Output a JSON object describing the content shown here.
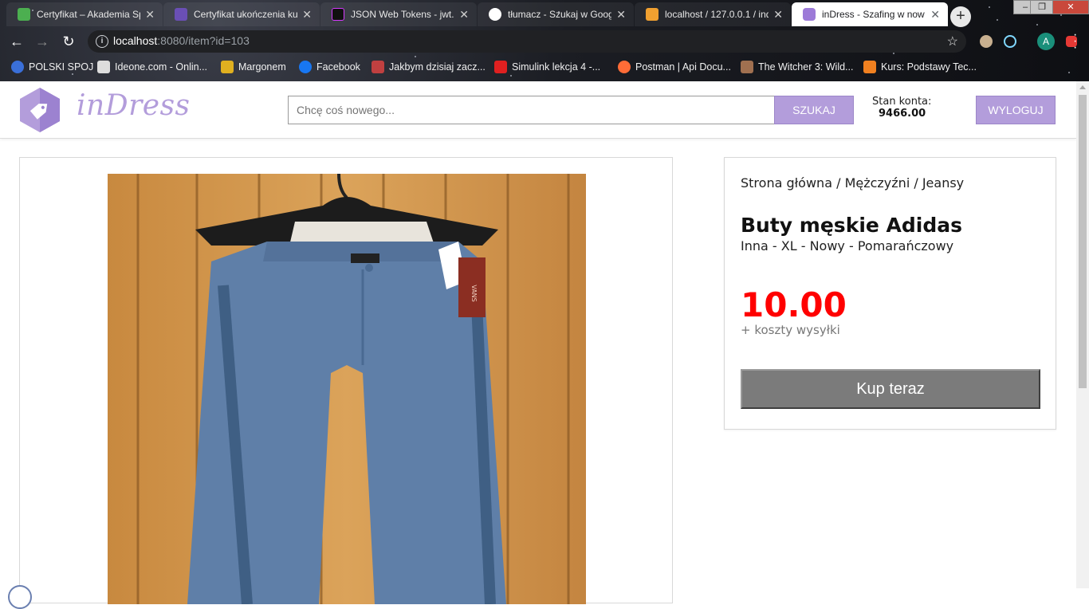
{
  "browser": {
    "tabs": [
      {
        "title": "Certyfikat – Akademia Sp",
        "favicon_color": "#4caf50"
      },
      {
        "title": "Certyfikat ukończenia ku",
        "favicon_color": "#6a4fb5"
      },
      {
        "title": "JSON Web Tokens - jwt.i",
        "favicon_color": "#101010"
      },
      {
        "title": "tłumacz - Szukaj w Goog",
        "favicon_color": "#ffffff"
      },
      {
        "title": "localhost / 127.0.0.1 / ind",
        "favicon_color": "#f0a030"
      },
      {
        "title": "inDress - Szafing w now",
        "favicon_color": "#9c7ad8"
      }
    ],
    "new_tab_label": "+",
    "address": {
      "host": "localhost",
      "path": ":8080/item?id=103"
    },
    "profile_initial": "A",
    "bookmarks": [
      {
        "label": "POLSKI SPOJ",
        "icon_color": "#3a6fd8"
      },
      {
        "label": "Ideone.com - Onlin...",
        "icon_color": "#dddddd"
      },
      {
        "label": "Margonem",
        "icon_color": "#e0b020"
      },
      {
        "label": "Facebook",
        "icon_color": "#1877f2"
      },
      {
        "label": "Jakbym dzisiaj zacz...",
        "icon_color": "#c04040"
      },
      {
        "label": "Simulink lekcja 4 -...",
        "icon_color": "#e02020"
      },
      {
        "label": "Postman | Api Docu...",
        "icon_color": "#ff6c37"
      },
      {
        "label": "The Witcher 3: Wild...",
        "icon_color": "#a07050"
      },
      {
        "label": "Kurs: Podstawy Tec...",
        "icon_color": "#f08020"
      }
    ]
  },
  "header": {
    "logo_text": "inDress",
    "search_placeholder": "Chcę coś nowego...",
    "search_button": "SZUKAJ",
    "balance_label": "Stan konta:",
    "balance_value": "9466.00",
    "logout_button": "WYLOGUJ"
  },
  "product": {
    "breadcrumb": "Strona główna / Mężczyźni / Jeansy",
    "title": "Buty męskie Adidas",
    "attributes": "Inna - XL - Nowy - Pomarańczowy",
    "price": "10.00",
    "shipping_note": "+ koszty wysyłki",
    "buy_button": "Kup teraz"
  },
  "colors": {
    "accent": "#b39ddb",
    "price": "#ff0000",
    "buy_button": "#7b7b7b"
  }
}
